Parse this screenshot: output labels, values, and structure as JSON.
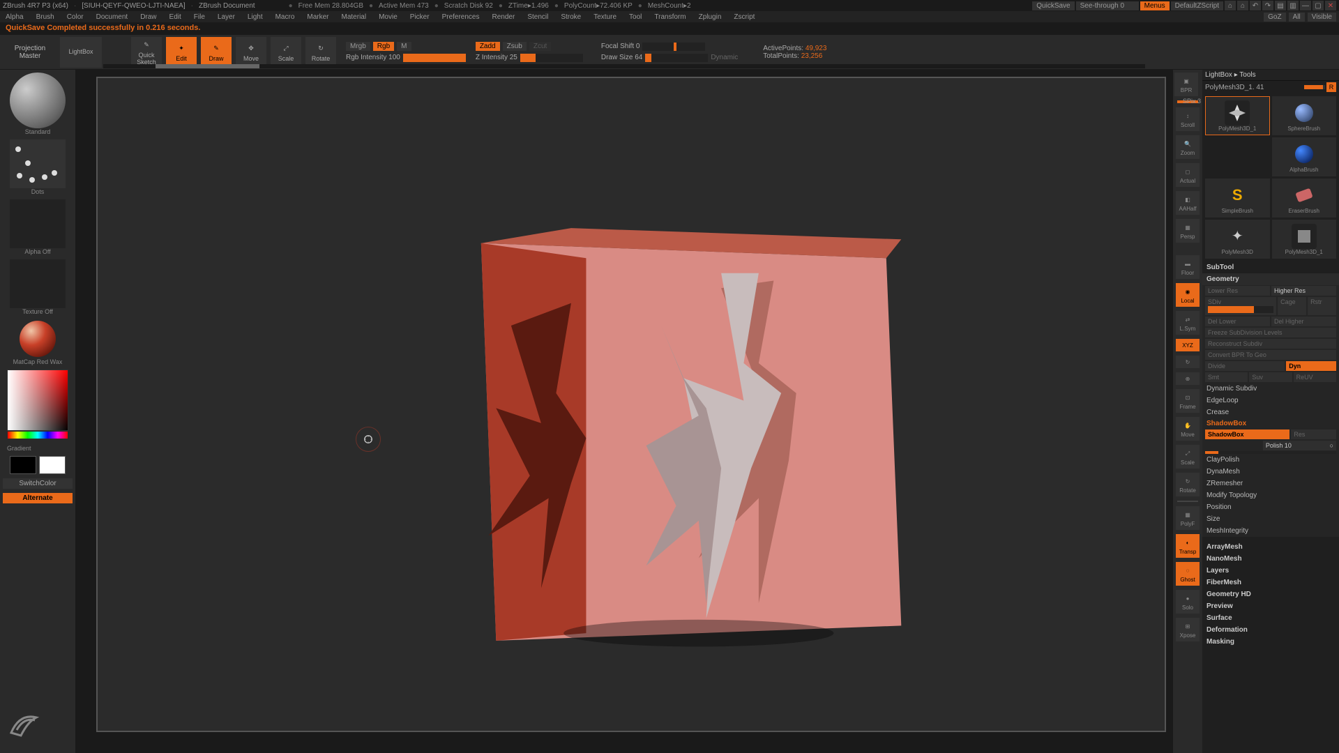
{
  "titlebar": {
    "app": "ZBrush 4R7 P3 (x64)",
    "doc_id": "[SIUH-QEYF-QWEO-LJTI-NAEA]",
    "doc_name": "ZBrush Document",
    "mem_free": "Free Mem 28.804GB",
    "mem_active": "Active Mem 473",
    "scratch": "Scratch Disk 92",
    "ztime": "ZTime▸1.496",
    "polycount": "PolyCount▸72.406 KP",
    "meshcount": "MeshCount▸2",
    "quicksave": "QuickSave",
    "seethrough": "See-through 0",
    "menus": "Menus",
    "defaultscript": "DefaultZScript"
  },
  "menubar": {
    "items": [
      "Alpha",
      "Brush",
      "Color",
      "Document",
      "Draw",
      "Edit",
      "File",
      "Layer",
      "Light",
      "Macro",
      "Marker",
      "Material",
      "Movie",
      "Picker",
      "Preferences",
      "Render",
      "Stencil",
      "Stroke",
      "Texture",
      "Tool",
      "Transform",
      "Zplugin",
      "Zscript"
    ],
    "right": {
      "goz": "GoZ",
      "all": "All",
      "visible": "Visible"
    }
  },
  "status": "QuickSave Completed successfully in 0.216 seconds.",
  "toptool": {
    "projection": "Projection\nMaster",
    "lightbox": "LightBox",
    "quicksketch": "Quick\nSketch",
    "edit": "Edit",
    "draw": "Draw",
    "move": "Move",
    "scale": "Scale",
    "rotate": "Rotate",
    "mrgb": "Mrgb",
    "rgb": "Rgb",
    "m": "M",
    "rgb_intensity": "Rgb Intensity 100",
    "zadd": "Zadd",
    "zsub": "Zsub",
    "zcut": "Zcut",
    "z_intensity": "Z Intensity 25",
    "focal": "Focal Shift 0",
    "drawsize": "Draw Size 64",
    "dynamic": "Dynamic",
    "activepoints_label": "ActivePoints:",
    "activepoints_value": "49,923",
    "totalpoints_label": "TotalPoints:",
    "totalpoints_value": "23,256"
  },
  "left": {
    "brush": "Standard",
    "stroke": "Dots",
    "alpha": "Alpha Off",
    "texture": "Texture Off",
    "material": "MatCap Red Wax",
    "gradient": "Gradient",
    "switchcolor": "SwitchColor",
    "alternate": "Alternate"
  },
  "rightbtns": {
    "items": [
      "BPR",
      "Scroll",
      "Zoom",
      "Actual",
      "AAHalf",
      "Persp",
      "Floor",
      "Local",
      "L.Sym",
      "XYZ",
      "",
      "",
      "Frame",
      "Move",
      "Scale",
      "Rotate",
      "PolyF",
      "Transp",
      "Ghost",
      "Solo",
      "Xpose"
    ],
    "spix": "SPix 3"
  },
  "rightpanel": {
    "header": "LightBox ▸ Tools",
    "current_tool": "PolyMesh3D_1. 41",
    "r_chip": "R",
    "tools": [
      {
        "name": "PolyMesh3D_1"
      },
      {
        "name": "SphereBrush"
      },
      {
        "name": "AlphaBrush"
      },
      {
        "name": "SimpleBrush"
      },
      {
        "name": "EraserBrush"
      },
      {
        "name": "PolyMesh3D"
      },
      {
        "name": "PolyMesh3D_1"
      }
    ],
    "subtool": "SubTool",
    "geometry": "Geometry",
    "geo": {
      "lowerres": "Lower Res",
      "higherres": "Higher Res",
      "sdiv": "SDiv",
      "cage": "Cage",
      "rstr": "Rstr",
      "dellower": "Del Lower",
      "delhigher": "Del Higher",
      "freeze": "Freeze SubDivision Levels",
      "reconstruct": "Reconstruct Subdiv",
      "convert": "Convert BPR To Geo",
      "divide": "Divide",
      "dyn": "Dyn",
      "smt": "Smt",
      "suv": "Suv",
      "resv": "ReUV"
    },
    "sections": [
      "Dynamic Subdiv",
      "EdgeLoop",
      "Crease",
      "ShadowBox",
      "ClayPolish",
      "DynaMesh",
      "ZRemesher",
      "Modify Topology",
      "Position",
      "Size",
      "MeshIntegrity"
    ],
    "shadowbox_btn": "ShadowBox",
    "shadowbox_res": "Res",
    "shadowbox_polish": "Polish 10",
    "after": [
      "ArrayMesh",
      "NanoMesh",
      "Layers",
      "FiberMesh",
      "Geometry HD",
      "Preview",
      "Surface",
      "Deformation",
      "Masking"
    ]
  }
}
